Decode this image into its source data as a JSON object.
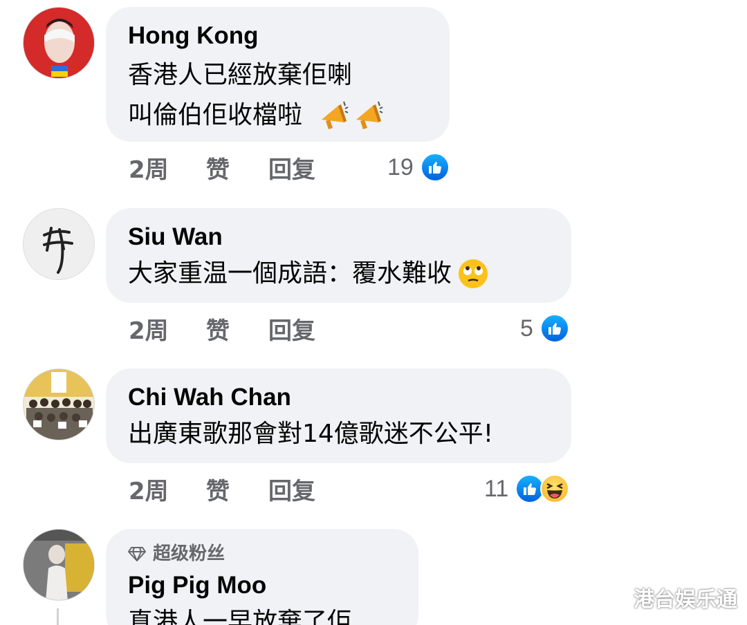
{
  "comments": [
    {
      "author": "Hong Kong",
      "lines": [
        "香港人已經放棄佢喇",
        "叫倫伯佢收檔啦"
      ],
      "line_emojis": [
        "",
        "megaphone-icon x2"
      ],
      "time": "2周",
      "like": "赞",
      "reply": "回复",
      "reaction_count": "19"
    },
    {
      "author": "Siu Wan",
      "lines": [
        "大家重温一個成語：覆水難收"
      ],
      "line_emojis": [
        "eye-roll-emoji-icon"
      ],
      "time": "2周",
      "like": "赞",
      "reply": "回复",
      "reaction_count": "5"
    },
    {
      "author": "Chi Wah Chan",
      "lines": [
        "出廣東歌那會對14億歌迷不公平!"
      ],
      "time": "2周",
      "like": "赞",
      "reply": "回复",
      "reaction_count": "11"
    },
    {
      "badge": "超级粉丝",
      "author": "Pig Pig Moo",
      "lines": [
        "真港人一早放棄了佢"
      ]
    }
  ],
  "watermark": "港台娱乐通",
  "colors": {
    "bubble": "#f0f2f5",
    "meta_text": "#65676b",
    "like_blue": "#0866ff"
  }
}
